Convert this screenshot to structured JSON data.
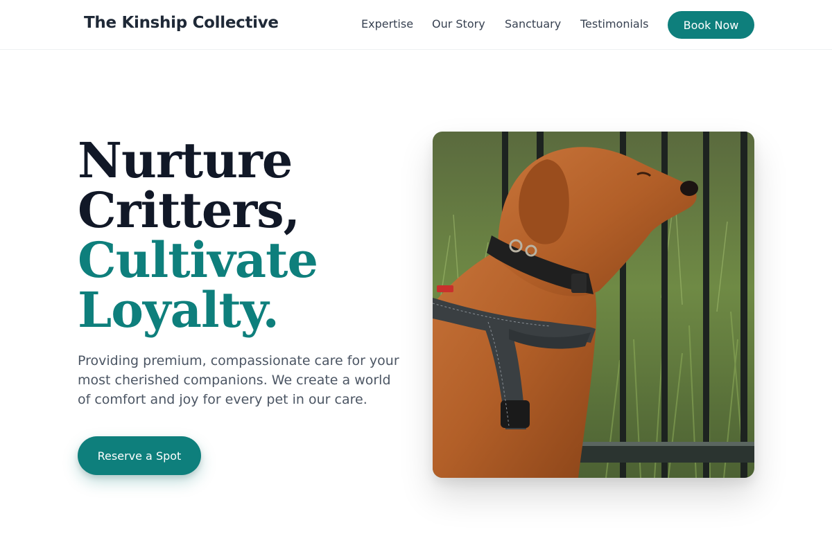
{
  "brand": {
    "name": "The Kinship Collective"
  },
  "nav": {
    "links": [
      {
        "label": "Expertise"
      },
      {
        "label": "Our Story"
      },
      {
        "label": "Sanctuary"
      },
      {
        "label": "Testimonials"
      }
    ],
    "cta_label": "Book Now"
  },
  "hero": {
    "headline": {
      "line1": "Nurture",
      "line2": "Critters,",
      "line3": "Cultivate",
      "line4": "Loyalty."
    },
    "subtext": "Providing premium, compassionate care for your most cherished companions. We create a world of comfort and joy for every pet in our care.",
    "cta_label": "Reserve a Spot",
    "image_subject": "dog-photo"
  },
  "colors": {
    "accent": "#0e7f7c",
    "headline_dark": "#111827",
    "body_text": "#4b5563"
  }
}
